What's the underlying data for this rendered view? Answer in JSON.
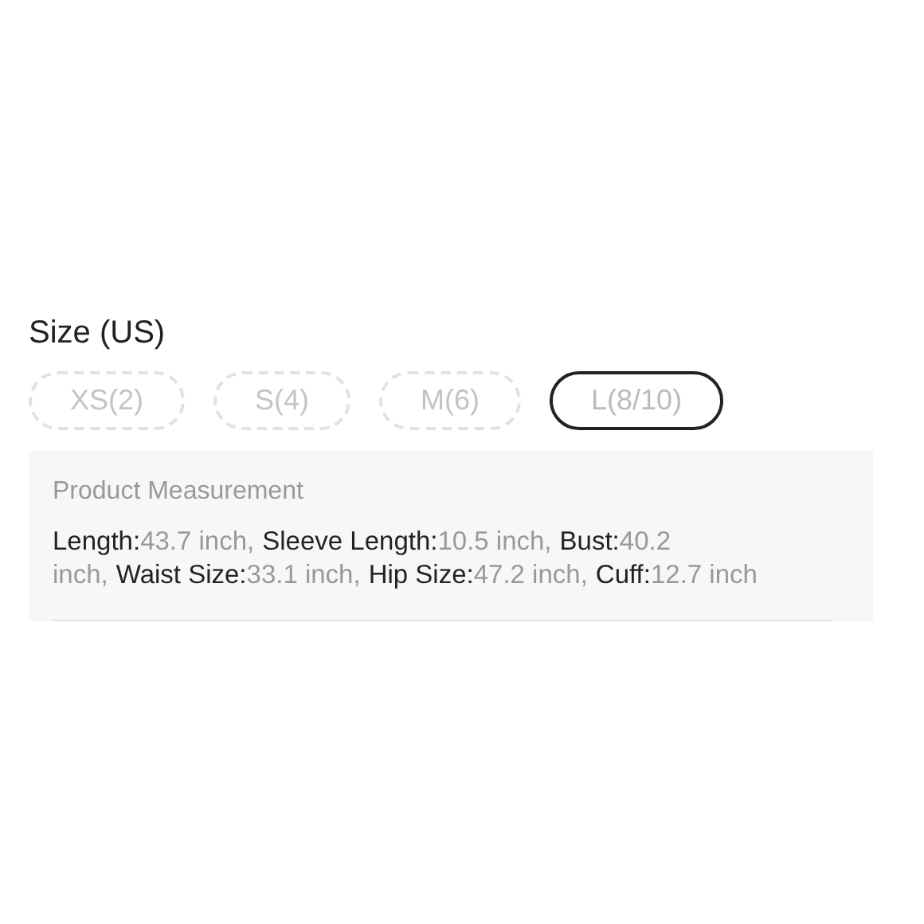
{
  "size_label": "Size (US)",
  "sizes": [
    {
      "label": "XS(2)",
      "disabled": true,
      "selected": false
    },
    {
      "label": "S(4)",
      "disabled": true,
      "selected": false
    },
    {
      "label": "M(6)",
      "disabled": true,
      "selected": false
    },
    {
      "label": "L(8/10)",
      "disabled": false,
      "selected": true
    }
  ],
  "measurement": {
    "title": "Product Measurement",
    "items": [
      {
        "label": "Length:",
        "value": "43.7 inch,"
      },
      {
        "label": "Sleeve Length:",
        "value": "10.5 inch,"
      },
      {
        "label": "Bust:",
        "value": "40.2 inch,"
      },
      {
        "label": "Waist Size:",
        "value": "33.1 inch,"
      },
      {
        "label": "Hip Size:",
        "value": "47.2 inch,"
      },
      {
        "label": "Cuff:",
        "value": "12.7 inch"
      }
    ]
  }
}
